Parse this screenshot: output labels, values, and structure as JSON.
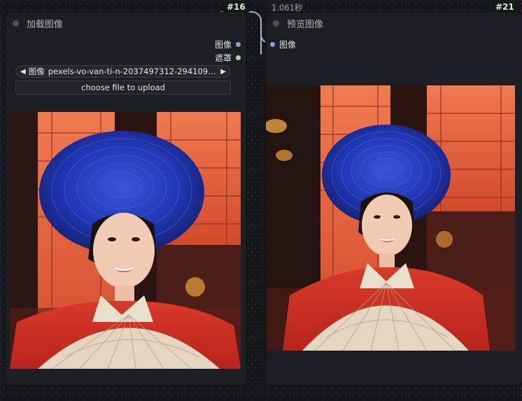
{
  "timer": "1.061秒",
  "load_node": {
    "id_badge": "#16",
    "title": "加载图像",
    "outputs": [
      {
        "label": "图像",
        "color": "#8aa0c8"
      },
      {
        "label": "遮罩",
        "color": "#b8d0a0"
      }
    ],
    "image_combo": {
      "name": "图像",
      "value": "pexels-vo-van-ti-n-2037497312-29410961..."
    },
    "upload_label": "choose file to upload"
  },
  "preview_node": {
    "id_badge": "#21",
    "title": "预览图像",
    "input": {
      "label": "图像",
      "color": "#8aa0c8"
    }
  },
  "colors": {
    "node_bg": "#1b1e22",
    "canvas_bg": "#141619",
    "link": "#a8b4c4"
  }
}
